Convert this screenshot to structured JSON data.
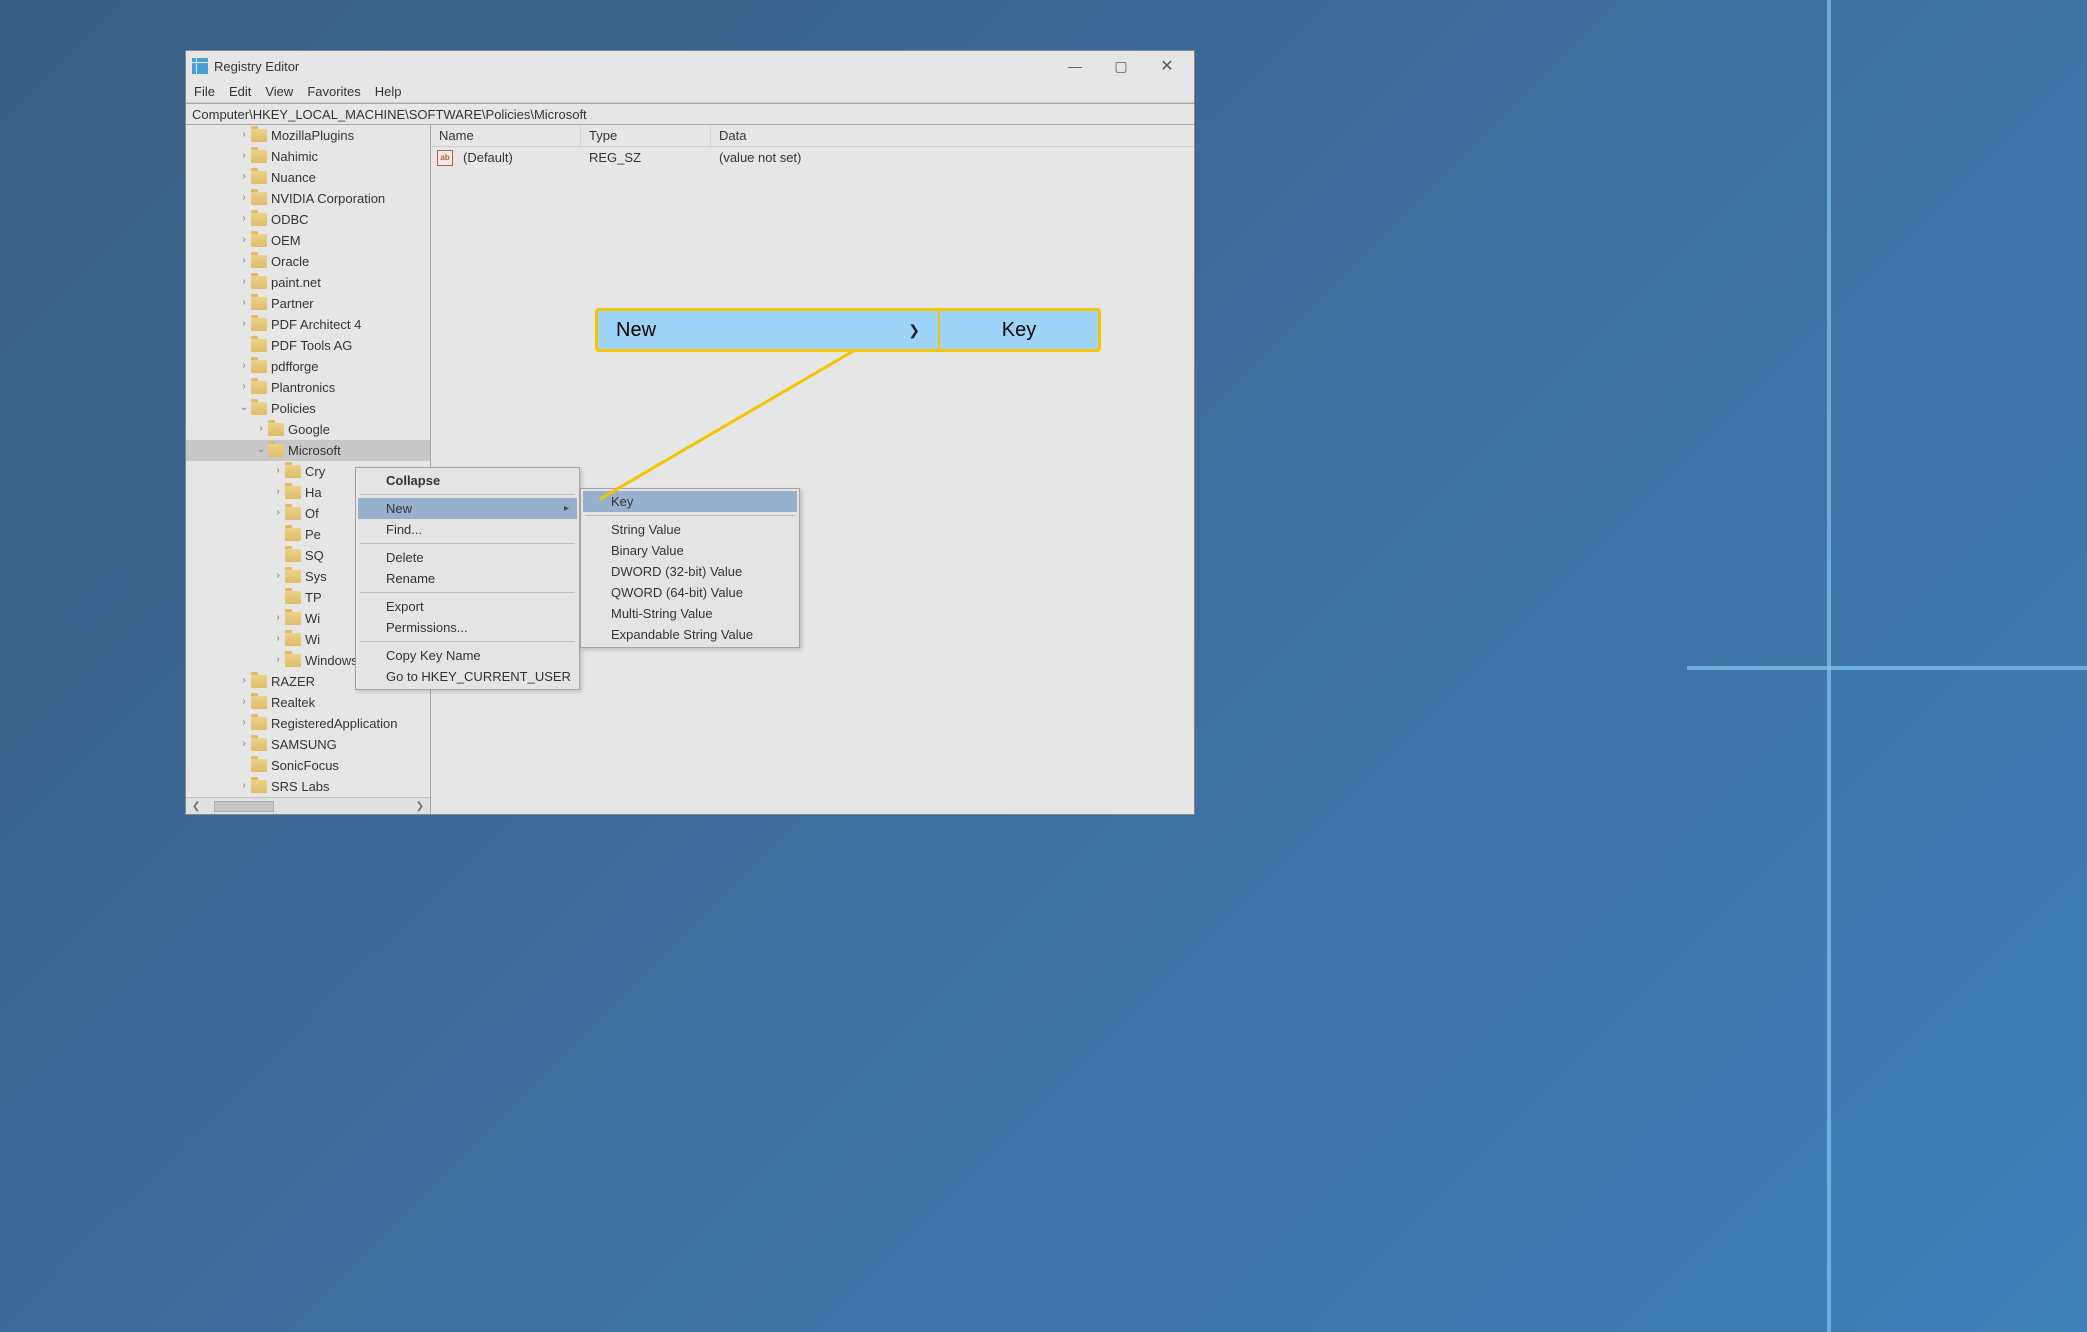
{
  "window": {
    "title": "Registry Editor",
    "controls": {
      "min": "—",
      "max": "▢",
      "close": "✕"
    }
  },
  "menu": {
    "file": "File",
    "edit": "Edit",
    "view": "View",
    "favorites": "Favorites",
    "help": "Help"
  },
  "address": "Computer\\HKEY_LOCAL_MACHINE\\SOFTWARE\\Policies\\Microsoft",
  "tree": {
    "items": [
      {
        "depth": 3,
        "expander": ">",
        "label": "MozillaPlugins"
      },
      {
        "depth": 3,
        "expander": ">",
        "label": "Nahimic"
      },
      {
        "depth": 3,
        "expander": ">",
        "label": "Nuance"
      },
      {
        "depth": 3,
        "expander": ">",
        "label": "NVIDIA Corporation"
      },
      {
        "depth": 3,
        "expander": ">",
        "label": "ODBC"
      },
      {
        "depth": 3,
        "expander": ">",
        "label": "OEM"
      },
      {
        "depth": 3,
        "expander": ">",
        "label": "Oracle"
      },
      {
        "depth": 3,
        "expander": ">",
        "label": "paint.net"
      },
      {
        "depth": 3,
        "expander": ">",
        "label": "Partner"
      },
      {
        "depth": 3,
        "expander": ">",
        "label": "PDF Architect 4"
      },
      {
        "depth": 3,
        "expander": "",
        "label": "PDF Tools AG"
      },
      {
        "depth": 3,
        "expander": ">",
        "label": "pdfforge"
      },
      {
        "depth": 3,
        "expander": ">",
        "label": "Plantronics"
      },
      {
        "depth": 3,
        "expander": "v",
        "label": "Policies"
      },
      {
        "depth": 4,
        "expander": ">",
        "label": "Google"
      },
      {
        "depth": 4,
        "expander": "v",
        "label": "Microsoft",
        "selected": true
      },
      {
        "depth": 5,
        "expander": ">",
        "label": "Cry"
      },
      {
        "depth": 5,
        "expander": ">",
        "label": "Ha"
      },
      {
        "depth": 5,
        "expander": ">",
        "label": "Of"
      },
      {
        "depth": 5,
        "expander": "",
        "label": "Pe"
      },
      {
        "depth": 5,
        "expander": "",
        "label": "SQ"
      },
      {
        "depth": 5,
        "expander": ">",
        "label": "Sys"
      },
      {
        "depth": 5,
        "expander": "",
        "label": "TP"
      },
      {
        "depth": 5,
        "expander": ">",
        "label": "Wi"
      },
      {
        "depth": 5,
        "expander": ">",
        "label": "Wi"
      },
      {
        "depth": 5,
        "expander": ">",
        "label": "Windows NT"
      },
      {
        "depth": 3,
        "expander": ">",
        "label": "RAZER"
      },
      {
        "depth": 3,
        "expander": ">",
        "label": "Realtek"
      },
      {
        "depth": 3,
        "expander": ">",
        "label": "RegisteredApplication"
      },
      {
        "depth": 3,
        "expander": ">",
        "label": "SAMSUNG"
      },
      {
        "depth": 3,
        "expander": "",
        "label": "SonicFocus"
      },
      {
        "depth": 3,
        "expander": ">",
        "label": "SRS Labs"
      }
    ]
  },
  "values": {
    "columns": {
      "name": "Name",
      "type": "Type",
      "data": "Data"
    },
    "rows": [
      {
        "icon": "ab",
        "name": "(Default)",
        "type": "REG_SZ",
        "data": "(value not set)"
      }
    ]
  },
  "contextMenu1": {
    "collapse": "Collapse",
    "new": "New",
    "find": "Find...",
    "delete": "Delete",
    "rename": "Rename",
    "export": "Export",
    "permissions": "Permissions...",
    "copyKeyName": "Copy Key Name",
    "goto": "Go to HKEY_CURRENT_USER"
  },
  "contextMenu2": {
    "key": "Key",
    "string": "String Value",
    "binary": "Binary Value",
    "dword": "DWORD (32-bit) Value",
    "qword": "QWORD (64-bit) Value",
    "multi": "Multi-String Value",
    "expand": "Expandable String Value"
  },
  "callout": {
    "new": "New",
    "key": "Key",
    "chev": "❯"
  },
  "scroll": {
    "left": "❮",
    "right": "❯"
  }
}
